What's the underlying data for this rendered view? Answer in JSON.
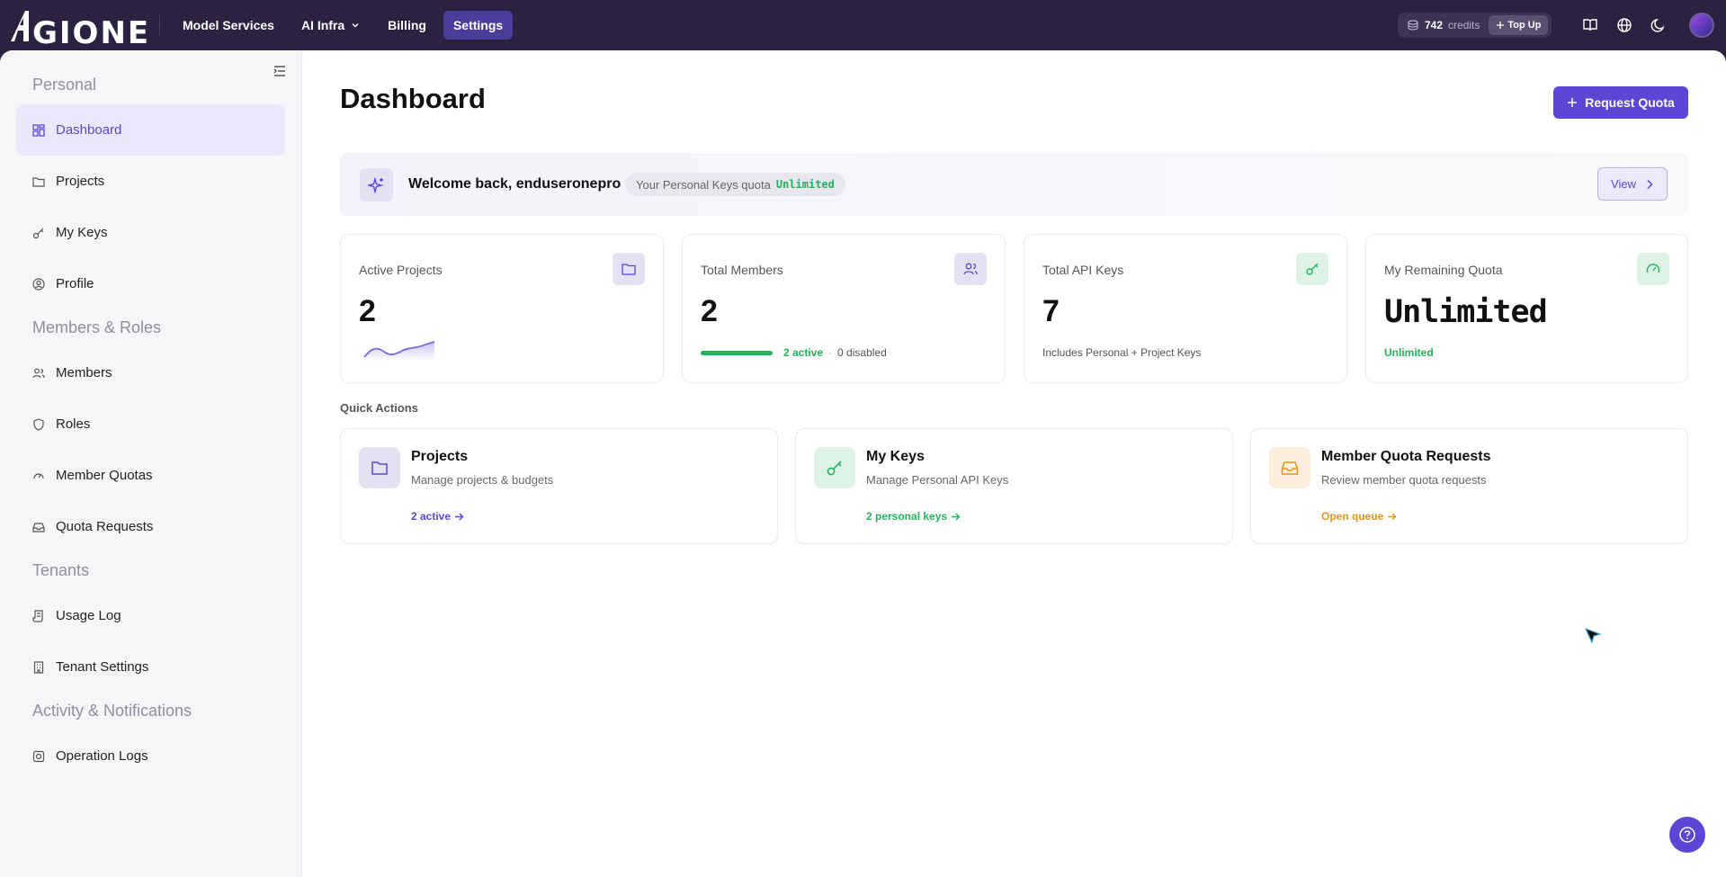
{
  "app": {
    "logo_text": "AIGIONE"
  },
  "nav": {
    "items": [
      {
        "label": "Model Services"
      },
      {
        "label": "AI Infra"
      },
      {
        "label": "Billing"
      },
      {
        "label": "Settings"
      }
    ]
  },
  "credits": {
    "amount": "742",
    "label": "credits",
    "topup_label": "Top Up"
  },
  "sidebar": {
    "sections": {
      "personal": "Personal",
      "members_roles": "Members & Roles",
      "tenants": "Tenants",
      "activity": "Activity & Notifications"
    },
    "items": {
      "dashboard": "Dashboard",
      "projects": "Projects",
      "my_keys": "My Keys",
      "profile": "Profile",
      "members": "Members",
      "roles": "Roles",
      "member_quotas": "Member Quotas",
      "quota_requests": "Quota Requests",
      "usage_log": "Usage Log",
      "tenant_settings": "Tenant Settings",
      "operation_logs": "Operation Logs"
    }
  },
  "main": {
    "title": "Dashboard",
    "request_quota_label": "Request Quota",
    "welcome": {
      "text": "Welcome back, enduseronepro",
      "quota_label": "Your Personal Keys quota",
      "quota_value": "Unlimited",
      "view_label": "View"
    },
    "stats": {
      "active_projects": {
        "label": "Active Projects",
        "value": "2"
      },
      "total_members": {
        "label": "Total Members",
        "value": "2",
        "active": "2 active",
        "disabled": "0 disabled",
        "active_fraction": 1.0
      },
      "api_keys": {
        "label": "Total API Keys",
        "value": "7",
        "sub": "Includes Personal + Project Keys"
      },
      "remaining_quota": {
        "label": "My Remaining Quota",
        "value": "Unlimited",
        "sub": "Unlimited"
      }
    },
    "quick_actions": {
      "title": "Quick Actions",
      "projects": {
        "title": "Projects",
        "desc": "Manage projects & budgets",
        "link": "2 active"
      },
      "my_keys": {
        "title": "My Keys",
        "desc": "Manage Personal API Keys",
        "link": "2 personal keys"
      },
      "quota_requests": {
        "title": "Member Quota Requests",
        "desc": "Review member quota requests",
        "link": "Open queue"
      }
    }
  },
  "colors": {
    "accent": "#5b46d6",
    "green": "#22b55c",
    "orange": "#e5961a",
    "topbar": "#2b2140"
  }
}
